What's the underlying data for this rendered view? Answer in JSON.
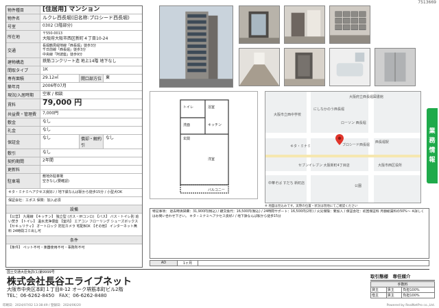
{
  "page_id": "7513669",
  "property": {
    "category_label": "物件種目",
    "category_value": "[住居用] マンション",
    "name_label": "物件名",
    "name_value": "ルクレ西長堀(旧名称:プロシード西長堀)",
    "room_label": "号室",
    "room_value": "0302 (3階部分)",
    "address_label": "所在地",
    "address_postal": "〒550-0013",
    "address_value": "大阪府大阪市西区新町４丁目10-24",
    "traffic_label": "交通",
    "traffic_lines": [
      "長堀鶴見緑地線「西長堀」徒歩3分",
      "千日前線「西長堀」徒歩3分",
      "中央線「阿波座」徒歩9分"
    ],
    "structure_label": "建物構造",
    "structure_value": "鉄筋コンクリート造 地上14階 地下なし",
    "layout_label": "間取タイプ",
    "layout_value": "1K",
    "area_label": "専有面積",
    "area_value": "29.12㎡",
    "direction_label": "開口部方位",
    "direction_value": "東",
    "built_label": "築年月",
    "built_value": "2006年07月",
    "moveout_label": "現況/入居時期",
    "moveout_value": "空家 / 相談",
    "rent_label": "賃料",
    "rent_value": "79,000 円",
    "fee_label": "共益費・管理費",
    "fee_value": "7,000円",
    "deposit_label": "敷金",
    "deposit_value": "なし",
    "key_money_label": "礼金",
    "key_money_value": "なし",
    "guarantee_label": "保証金",
    "guarantee_value": "なし",
    "amortize_label": "償却・解約引",
    "amortize_value": "なし",
    "shikibiki_label": "敷引",
    "shikibiki_value": "なし",
    "contract_label": "契約期間",
    "contract_value": "2年間",
    "renewal_label": "更新料",
    "renewal_value": "",
    "parking_label": "駐車場",
    "parking_lines": [
      "敷地外駐車場",
      "空きなし(要確認)"
    ],
    "access_note": "キタ・ミナミへアクセス良好♪ / 地下鉄なんば駅から徒歩15分 / 小型犬OK",
    "insurance_note": "保証会社：エポス 保険：加入必須",
    "equipment_head": "設備",
    "equipment_text": "【公営】 九電線 【キッチン】 独立型 (ガス・IHコンロ) 【バス】 バス・トイレ別 追い焚き 【トイレ】 温水洗浄便座 【室内】 エアコン フローリング シューズボックス 【セキュリティ】 オートロック 防犯カメラ 宅配BOX 【その他】 インターネット無料 24時間ゴミ出し可",
    "conditions_head": "条件",
    "conditions_text": "【条件】 ペット不可・楽器使用不可・事務所不可"
  },
  "photos": [
    {
      "name": "building-exterior-photo"
    },
    {
      "name": "entrance-photo"
    },
    {
      "name": "lobby-photo"
    },
    {
      "name": "mailbox-photo"
    },
    {
      "name": "hallway-photo"
    },
    {
      "name": "room-photo"
    },
    {
      "name": "bathroom-photo"
    },
    {
      "name": "elevator-photo"
    }
  ],
  "floorplan": {
    "labels": [
      "洋室",
      "キッチン",
      "バルコニー",
      "トイレ",
      "洗面",
      "浴室",
      "玄関"
    ]
  },
  "map": {
    "labels": [
      "大阪府立西長堀図書館",
      "にしなかのう西長堀",
      "ローソン 西長堀",
      "大阪市立西中学校",
      "西長堀駅",
      "ブロシード西長堀",
      "キタ・ミナミ",
      "セブンイレブン 大阪新町4丁目店",
      "中華そば すだち 新町店",
      "大阪市西区役所",
      "公園"
    ],
    "note": "※ 地図は見込みです。実際の位置・状況は現地にてご確認ください"
  },
  "feature_text": "特記事項： 退去時清掃費：31,900円(税込) / 鍵交換代：16,500円(税込) / 24時間サポート：16,500円(2年) / 火災保険：要加入 / 保証会社：初回保証料 月額総賃料の50%〜 ※詳しくはお問い合わせ下さい。 キタ・ミナミへアクセス良好♪ / 地下鉄なんば駅から徒歩15分",
  "ad": {
    "label": "AD",
    "value": "1ヶ月"
  },
  "side_tab_text": [
    "業",
    "務",
    "情",
    "報"
  ],
  "footer": {
    "license": "国土交通大臣免許(1)第9999号",
    "company": "株式会社長谷エライブネット",
    "address": "大阪市中央区本町１丁目8-12 オーク堺筋本町ビル2階",
    "tel": "TEL：06-6262-8450　FAX：06-6262-8480",
    "print_line": "印刷日：2024/07/02 13:38:49 / 登録日：2024/06/20",
    "powered": "Powered by RealNetPro co.,Ltd."
  },
  "commission": {
    "title": "取引態様　専任媒介",
    "head": "手数料",
    "rows": [
      [
        "貸主",
        "賃主",
        "負担100%"
      ],
      [
        "借主",
        "賃主",
        "負担100%"
      ]
    ]
  }
}
